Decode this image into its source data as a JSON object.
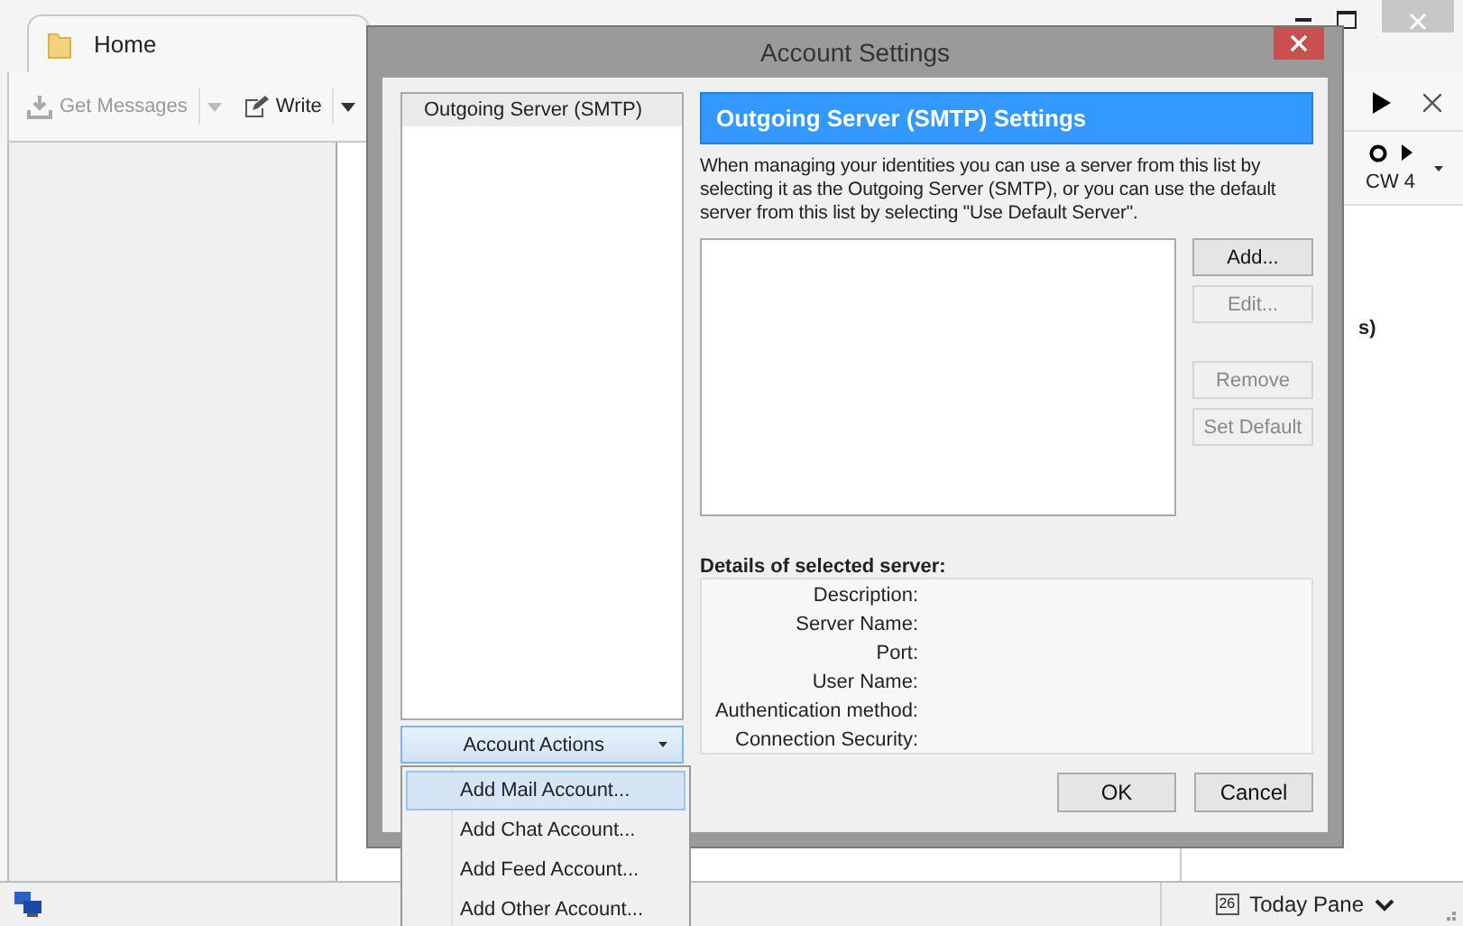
{
  "main_window": {
    "tab": {
      "label": "Home",
      "selected": true
    },
    "toolbar": [
      {
        "label": "Get Messages",
        "disabled": true
      },
      {
        "label": "Write",
        "disabled": false
      }
    ],
    "today_pane": {
      "week": "CW 4",
      "fragment": "s)"
    },
    "status_bar": {
      "calendar_day": "26",
      "today_pane_button": "Today Pane"
    }
  },
  "dialog": {
    "title": "Account Settings",
    "account_list": [
      {
        "label": "Outgoing Server (SMTP)",
        "selected": true
      }
    ],
    "account_actions": "Account Actions",
    "section_title": "Outgoing Server (SMTP) Settings",
    "description": "When managing your identities you can use a server from this list by selecting it as the Outgoing Server (SMTP), or you can use the default server from this list by selecting \"Use Default Server\".",
    "server_button_groups": [
      [
        {
          "label": "Add...",
          "disabled": false
        },
        {
          "label": "Edit...",
          "disabled": true
        }
      ],
      [
        {
          "label": "Remove",
          "disabled": true
        },
        {
          "label": "Set Default",
          "disabled": true
        }
      ]
    ],
    "details_title": "Details of selected server:",
    "details_fields": [
      "Description:",
      "Server Name:",
      "Port:",
      "User Name:",
      "Authentication method:",
      "Connection Security:"
    ],
    "buttons": [
      "OK",
      "Cancel"
    ]
  },
  "menu": [
    {
      "label": "Add Mail Account...",
      "selected": true
    },
    {
      "label": "Add Chat Account...",
      "selected": false
    },
    {
      "label": "Add Feed Account...",
      "selected": false
    },
    {
      "label": "Add Other Account...",
      "selected": false
    }
  ]
}
